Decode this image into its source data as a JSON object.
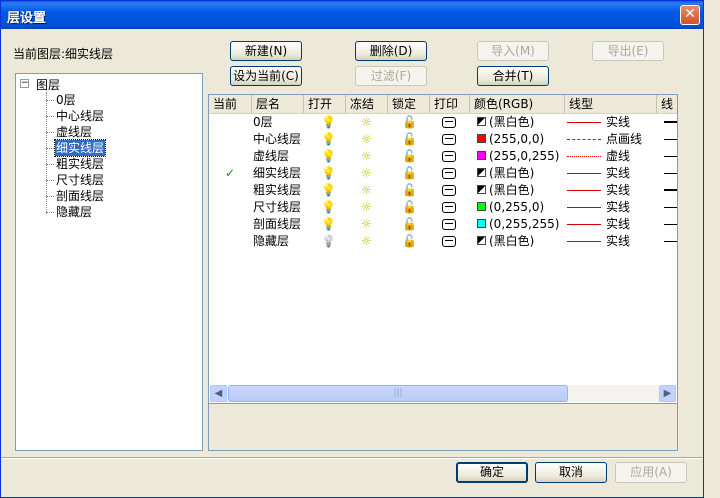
{
  "window": {
    "title": "层设置",
    "close_glyph": "✕"
  },
  "current_layer": "当前图层:细实线层",
  "buttons": {
    "new": "新建(N)",
    "delete": "删除(D)",
    "import": "导入(M)",
    "export": "导出(E)",
    "set_current": "设为当前(C)",
    "filter": "过滤(F)",
    "merge": "合并(T)",
    "ok": "确定",
    "cancel": "取消",
    "apply": "应用(A)"
  },
  "tree": {
    "root": "图层",
    "expander": "−",
    "items": [
      "0层",
      "中心线层",
      "虚线层",
      "细实线层",
      "粗实线层",
      "尺寸线层",
      "剖面线层",
      "隐藏层"
    ],
    "selected": "细实线层"
  },
  "table": {
    "columns": [
      "当前",
      "层名",
      "打开",
      "冻结",
      "锁定",
      "打印",
      "颜色(RGB)",
      "线型",
      "线"
    ],
    "rows": [
      {
        "current": "",
        "name": "0层",
        "open": true,
        "color_hex": "bw",
        "color": "(黑白色)",
        "linetype_style": "solid",
        "linetype": "实线",
        "lw": "thick"
      },
      {
        "current": "",
        "name": "中心线层",
        "open": true,
        "color_hex": "#ff0000",
        "color": "(255,0,0)",
        "linetype_style": "dashdot",
        "linetype": "点画线",
        "lw": "thin"
      },
      {
        "current": "",
        "name": "虚线层",
        "open": true,
        "color_hex": "#ff00ff",
        "color": "(255,0,255)",
        "linetype_style": "dotted",
        "linetype": "虚线",
        "lw": "thin"
      },
      {
        "current": "✓",
        "name": "细实线层",
        "open": true,
        "color_hex": "bw",
        "color": "(黑白色)",
        "linetype_style": "solid",
        "linetype": "实线",
        "lw": "thin"
      },
      {
        "current": "",
        "name": "粗实线层",
        "open": true,
        "color_hex": "bw",
        "color": "(黑白色)",
        "linetype_style": "solid",
        "linetype": "实线",
        "lw": "thick"
      },
      {
        "current": "",
        "name": "尺寸线层",
        "open": true,
        "color_hex": "#00ff00",
        "color": "(0,255,0)",
        "linetype_style": "solid",
        "linetype": "实线",
        "lw": "thin"
      },
      {
        "current": "",
        "name": "剖面线层",
        "open": true,
        "color_hex": "#00ffff",
        "color": "(0,255,255)",
        "linetype_style": "solid",
        "linetype": "实线",
        "lw": "thin"
      },
      {
        "current": "",
        "name": "隐藏层",
        "open": false,
        "color_hex": "bw",
        "color": "(黑白色)",
        "linetype_style": "solid",
        "linetype": "实线",
        "lw": "thin"
      }
    ]
  },
  "icons": {
    "bulb": "💡",
    "sun": "☼",
    "lock": "🔓",
    "scroll_left": "◀",
    "scroll_right": "▶",
    "grip": "|||"
  },
  "colors": {
    "title_bar": "#0058e6",
    "selection": "#316ac5",
    "current_check": "#1a8f1a"
  }
}
